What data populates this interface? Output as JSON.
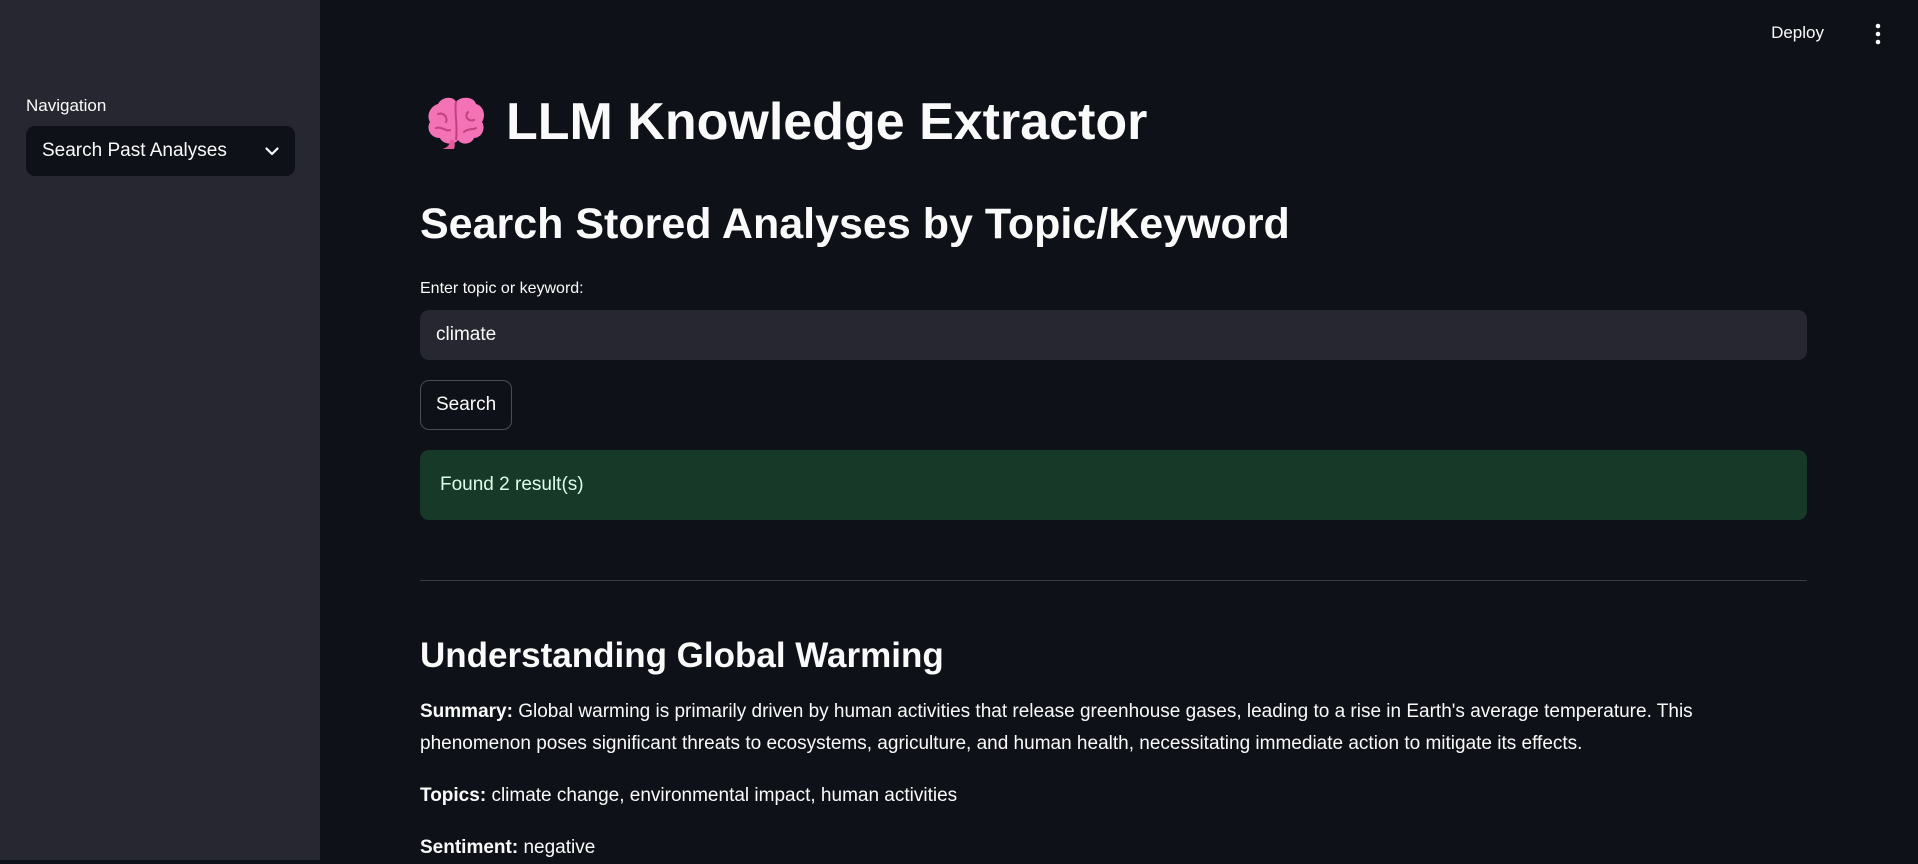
{
  "sidebar": {
    "nav_label": "Navigation",
    "nav_selected": "Search Past Analyses"
  },
  "topbar": {
    "deploy_label": "Deploy",
    "menu_icon": "vertical-dots-icon"
  },
  "main": {
    "app_icon": "brain-emoji-icon",
    "app_title": "LLM Knowledge Extractor",
    "section_title": "Search Stored Analyses by Topic/Keyword",
    "input_label": "Enter topic or keyword:",
    "input_value": "climate",
    "search_button_label": "Search",
    "result_status": "Found 2 result(s)"
  },
  "result": {
    "title": "Understanding Global Warming",
    "summary_label": "Summary:",
    "summary_text": "Global warming is primarily driven by human activities that release greenhouse gases, leading to a rise in Earth's average temperature. This phenomenon poses significant threats to ecosystems, agriculture, and human health, necessitating immediate action to mitigate its effects.",
    "topics_label": "Topics:",
    "topics_text": "climate change, environmental impact, human activities",
    "sentiment_label": "Sentiment:",
    "sentiment_text": "negative"
  },
  "colors": {
    "background": "#0e1117",
    "sidebar": "#262730",
    "success_bg": "#173928",
    "brain": "#f472b6"
  }
}
